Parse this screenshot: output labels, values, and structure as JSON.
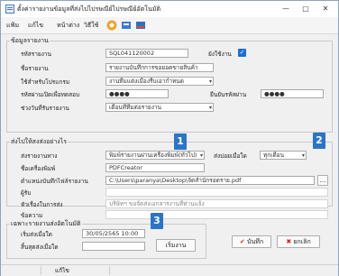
{
  "window": {
    "title": "ตั้งค่ารายงานข้อมูลที่ส่งไปไปรษณีย์ไปรษณีย์อัตโนมัติ",
    "minimize": "—",
    "maximize": "▢",
    "close": "✕"
  },
  "menu": {
    "items": [
      "แฟ้ม",
      "แก้ไข",
      "หน้าต่าง",
      "วิธีใช้"
    ]
  },
  "section_info": {
    "title": "ข้อมูลรายงาน",
    "report_code_label": "รหัสรายงาน",
    "report_code": "SQL041120002",
    "active_label": "ยังใช้งาน",
    "report_name_label": "ชื่อรายงาน",
    "report_name": "รายงานบันทึกการขอยอดขายสินค้า",
    "open_with_label": "ใช้สำหรับโปรแกรม",
    "open_with": "งานทีมแต่งเมืองรีบเอากำหนด",
    "open_pass_label": "รหัสผ่านเปิดเพื่อทดสอบ",
    "open_pass": "●●●●",
    "confirm_pass_label": "ยืนยันรหัสผ่าน",
    "confirm_pass": "●●●●",
    "run_time_label": "ช่วงวันที่รันรายงาน",
    "run_time": "เดือนที่ทีมต่อรายงาน"
  },
  "section_send": {
    "title": "ส่งไปให้สงส่งอย่างไร",
    "send_type_label": "ส่งรายงานทาง",
    "send_type": "พิมพ์รายงานผ่านเครื่องพิมพ์(ทั่วไป)",
    "frequency_label": "ส่งบ่อยเมื่อใด",
    "frequency": "ทุกเดือน",
    "printer_label": "ชื่อเครื่องพิมพ์",
    "printer": "PDFCreator",
    "path_label": "ตำแหน่งบันทึกไฟล์รายงาน",
    "path": "C:\\Users\\paranya\\Desktop\\จัดสำนักรอดราย.pdf",
    "browse": "...",
    "to_label": "ผู้รับ",
    "subject_label": "หัวเรื่องในการส่ง",
    "subject": "บริษัทฯ ขอจัดส่งเอกสารงานที่ท่านแจ้ง",
    "message_label": "ข้อความ"
  },
  "section_auto": {
    "title": "เฉพาะรายงานส่งอัตโนมัติ",
    "start_label": "เริ่มส่งเมื่อใด",
    "start": "30/05/2565 10:00",
    "end_label": "สิ้นสุดส่งเมื่อใด",
    "start_button": "เริ่มงาน"
  },
  "buttons": {
    "save": "บันทึก",
    "cancel": "ยกเลิก"
  },
  "badges": [
    "1",
    "2",
    "3"
  ],
  "status": {
    "left": "แก้ไข"
  },
  "colors": {
    "accent": "#2a74c9",
    "check": "#1e6fd0",
    "save_check": "#e02a2a",
    "cancel_x": "#d01c1c"
  },
  "icons": [
    "app-icon",
    "help-icon",
    "printer-icon",
    "mail-icon",
    "exit-icon",
    "check-icon",
    "x-icon"
  ]
}
